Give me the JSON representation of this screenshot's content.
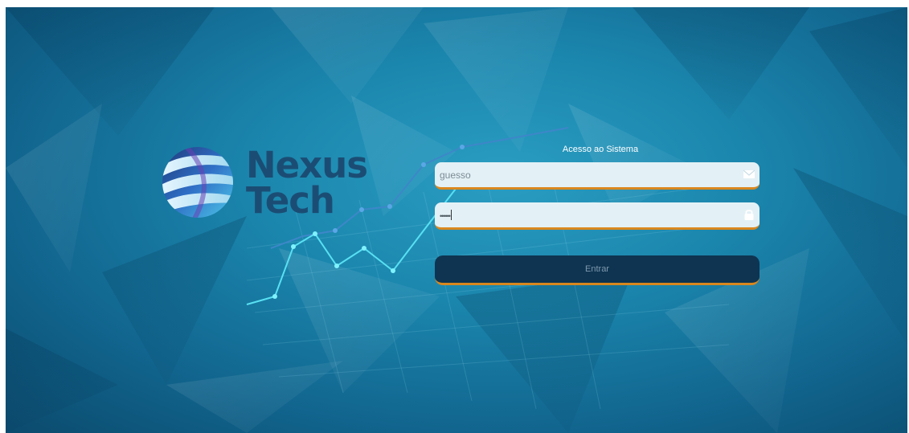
{
  "brand": {
    "line1": "Nexus",
    "line2": "Tech",
    "color": "#1b4d74",
    "globe_icon": "globe-logo-icon"
  },
  "login": {
    "title": "Acesso ao Sistema",
    "username": {
      "value": "guesso",
      "icon": "envelope-icon"
    },
    "password": {
      "value": "••••••",
      "icon": "lock-icon"
    },
    "submit_label": "Entrar"
  },
  "colors": {
    "background": "#1b86ad",
    "field_background": "#e3f1f6",
    "field_underline": "#d9871e",
    "button_background": "#0e3451",
    "button_text": "#7f98ad"
  }
}
